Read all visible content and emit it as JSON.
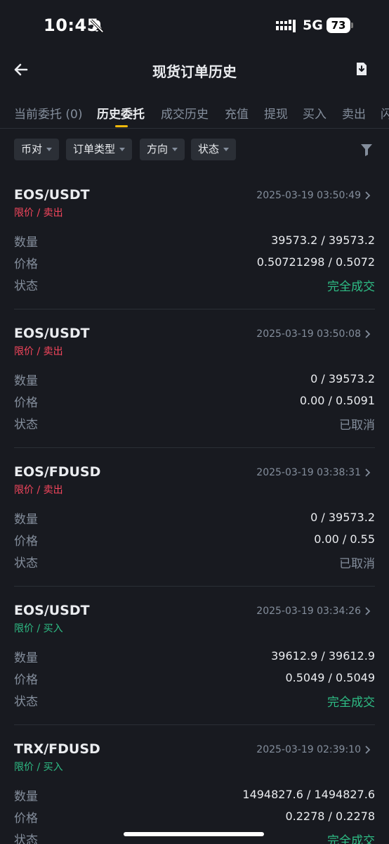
{
  "status_bar": {
    "time": "10:45",
    "network": "5G",
    "battery": "73"
  },
  "header": {
    "title": "现货订单历史"
  },
  "tabs": [
    {
      "label": "当前委托 (0)"
    },
    {
      "label": "历史委托"
    },
    {
      "label": "成交历史"
    },
    {
      "label": "充值"
    },
    {
      "label": "提现"
    },
    {
      "label": "买入"
    },
    {
      "label": "卖出"
    },
    {
      "label": "闪"
    }
  ],
  "filters": [
    {
      "label": "币对"
    },
    {
      "label": "订单类型"
    },
    {
      "label": "方向"
    },
    {
      "label": "状态"
    }
  ],
  "labels": {
    "quantity": "数量",
    "price": "价格",
    "status": "状态"
  },
  "orders": [
    {
      "pair": "EOS/USDT",
      "time": "2025-03-19 03:50:49",
      "type": "限价 / 卖出",
      "quantity": "39573.2 / 39573.2",
      "price": "0.50721298 / 0.5072",
      "status": "完全成交"
    },
    {
      "pair": "EOS/USDT",
      "time": "2025-03-19 03:50:08",
      "type": "限价 / 卖出",
      "quantity": "0 / 39573.2",
      "price": "0.00 / 0.5091",
      "status": "已取消"
    },
    {
      "pair": "EOS/FDUSD",
      "time": "2025-03-19 03:38:31",
      "type": "限价 / 卖出",
      "quantity": "0 / 39573.2",
      "price": "0.00 / 0.55",
      "status": "已取消"
    },
    {
      "pair": "EOS/USDT",
      "time": "2025-03-19 03:34:26",
      "type": "限价 / 买入",
      "quantity": "39612.9 / 39612.9",
      "price": "0.5049 / 0.5049",
      "status": "完全成交"
    },
    {
      "pair": "TRX/FDUSD",
      "time": "2025-03-19 02:39:10",
      "type": "限价 / 买入",
      "quantity": "1494827.6 / 1494827.6",
      "price": "0.2278 / 0.2278",
      "status": "完全成交"
    }
  ],
  "colors": {
    "background": "#181a20",
    "accent": "#f0b90b",
    "sell": "#f6465d",
    "buy": "#2ebd85",
    "muted": "#848e9c"
  }
}
